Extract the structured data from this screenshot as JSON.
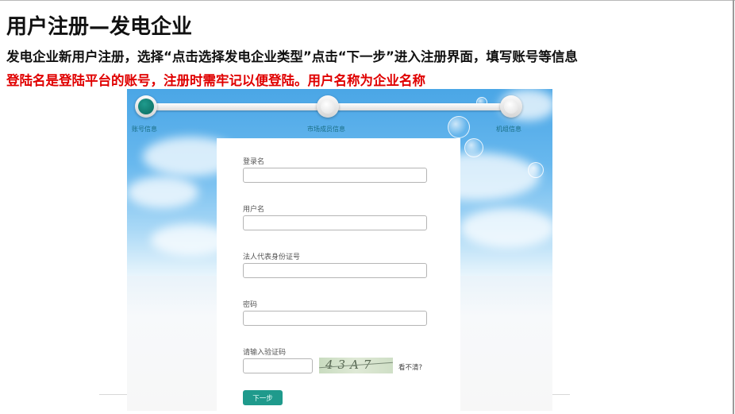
{
  "doc": {
    "title": "用户注册—发电企业",
    "instruction": "发电企业新用户注册，选择“点击选择发电企业类型”点击“下一步”进入注册界面，填写账号等信息",
    "note": "登陆名是登陆平台的账号，注册时需牢记以便登陆。用户名称为企业名称"
  },
  "steps": [
    {
      "label": "账号信息",
      "active": true
    },
    {
      "label": "市场成员信息",
      "active": false
    },
    {
      "label": "机组信息",
      "active": false
    }
  ],
  "form": {
    "login_label": "登录名",
    "login_value": "",
    "username_label": "用户名",
    "username_value": "",
    "id_label": "法人代表身份证号",
    "id_value": "",
    "password_label": "密码",
    "password_value": "",
    "captcha_label": "请输入验证码",
    "captcha_value": "",
    "captcha_text": "43A7",
    "refresh_label": "看不清?",
    "next_label": "下一步"
  },
  "colors": {
    "accent": "#1f9a8c",
    "note_red": "#e00000",
    "step_label": "#1a6f86"
  }
}
